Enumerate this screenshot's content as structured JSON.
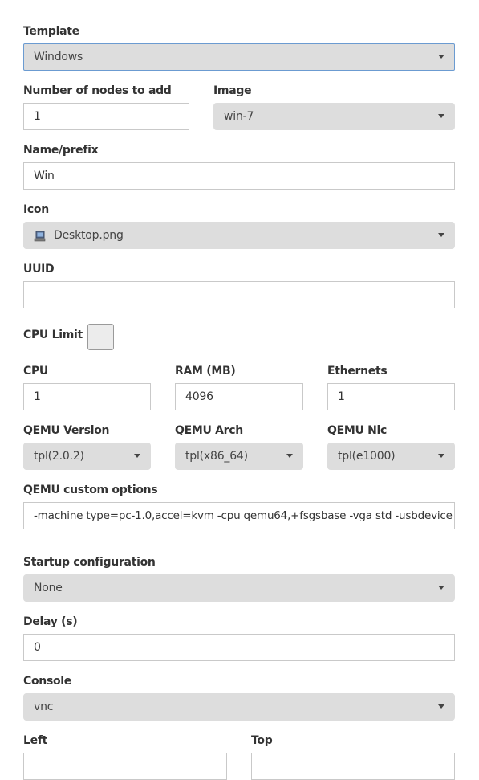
{
  "template": {
    "label": "Template",
    "value": "Windows"
  },
  "nodes": {
    "label": "Number of nodes to add",
    "value": "1"
  },
  "image": {
    "label": "Image",
    "value": "win-7"
  },
  "name": {
    "label": "Name/prefix",
    "value": "Win"
  },
  "icon": {
    "label": "Icon",
    "value": "Desktop.png",
    "icon_name": "desktop-computer-icon"
  },
  "uuid": {
    "label": "UUID",
    "value": ""
  },
  "cpu_limit": {
    "label": "CPU Limit",
    "checked": false
  },
  "cpu": {
    "label": "CPU",
    "value": "1"
  },
  "ram": {
    "label": "RAM (MB)",
    "value": "4096"
  },
  "ethernets": {
    "label": "Ethernets",
    "value": "1"
  },
  "qemu_version": {
    "label": "QEMU Version",
    "value": "tpl(2.0.2)"
  },
  "qemu_arch": {
    "label": "QEMU Arch",
    "value": "tpl(x86_64)"
  },
  "qemu_nic": {
    "label": "QEMU Nic",
    "value": "tpl(e1000)"
  },
  "qemu_options": {
    "label": "QEMU custom options",
    "value": "-machine type=pc-1.0,accel=kvm -cpu qemu64,+fsgsbase -vga std -usbdevice tablet"
  },
  "startup": {
    "label": "Startup configuration",
    "value": "None"
  },
  "delay": {
    "label": "Delay (s)",
    "value": "0"
  },
  "console": {
    "label": "Console",
    "value": "vnc"
  },
  "left": {
    "label": "Left",
    "value": ""
  },
  "top": {
    "label": "Top",
    "value": ""
  },
  "colors": {
    "select_bg": "#dddddd",
    "focus_border": "#6b9bd1",
    "border": "#c9c9c9"
  }
}
